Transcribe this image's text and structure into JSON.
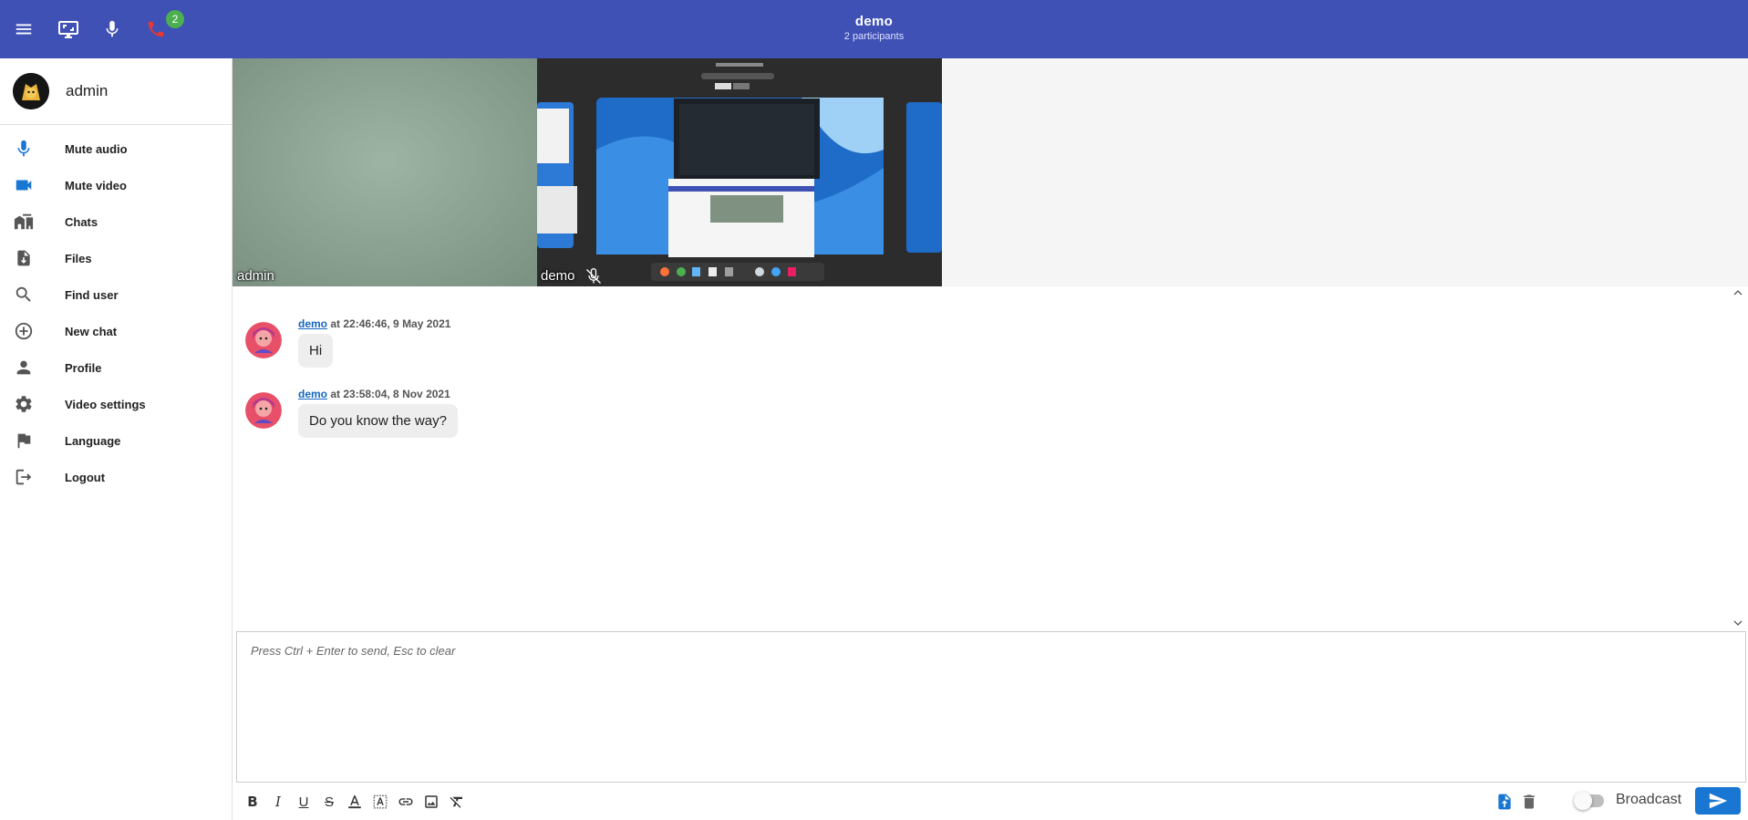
{
  "header": {
    "title": "demo",
    "subtitle": "2 participants",
    "badge_count": "2"
  },
  "user": {
    "name": "admin"
  },
  "nav": [
    {
      "label": "Mute audio",
      "icon": "microphone-icon"
    },
    {
      "label": "Mute video",
      "icon": "videocam-icon"
    },
    {
      "label": "Chats",
      "icon": "chats-icon"
    },
    {
      "label": "Files",
      "icon": "file-download-icon"
    },
    {
      "label": "Find user",
      "icon": "search-icon"
    },
    {
      "label": "New chat",
      "icon": "add-circle-icon"
    },
    {
      "label": "Profile",
      "icon": "person-icon"
    },
    {
      "label": "Video settings",
      "icon": "gear-icon"
    },
    {
      "label": "Language",
      "icon": "flag-icon"
    },
    {
      "label": "Logout",
      "icon": "logout-icon"
    }
  ],
  "videos": [
    {
      "label": "admin"
    },
    {
      "label": "demo"
    }
  ],
  "messages": [
    {
      "author": "demo",
      "when": " at 22:46:46, 9 May 2021",
      "text": "Hi"
    },
    {
      "author": "demo",
      "when": " at 23:58:04, 8 Nov 2021",
      "text": "Do you know the way?"
    }
  ],
  "editor": {
    "placeholder": "Press Ctrl + Enter to send, Esc to clear"
  },
  "toolbar": {
    "broadcast_label": "Broadcast"
  },
  "colors": {
    "appbar": "#3f51b5",
    "accent": "#1976d2",
    "call_red": "#e53935",
    "badge_green": "#4caf50"
  }
}
